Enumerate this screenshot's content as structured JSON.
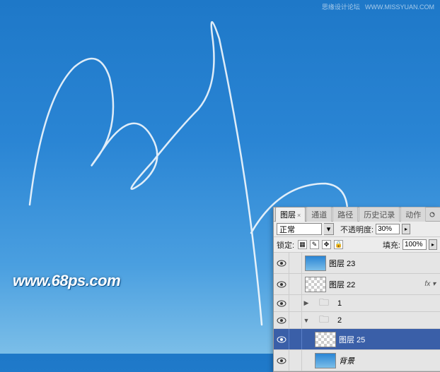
{
  "watermark": {
    "title": "思缘设计论坛",
    "url": "WWW.MISSYUAN.COM"
  },
  "logo": "www.68ps.com",
  "panel": {
    "tabs": [
      "图层",
      "通道",
      "路径",
      "历史记录",
      "动作"
    ],
    "blend_mode": "正常",
    "opacity_label": "不透明度:",
    "opacity_value": "30%",
    "lock_label": "锁定:",
    "fill_label": "填充:",
    "fill_value": "100%",
    "layers": [
      {
        "name": "图层 23",
        "thumb": "blue",
        "fx": false
      },
      {
        "name": "图层 22",
        "thumb": "checker",
        "fx": true
      },
      {
        "name": "1",
        "thumb": "folder",
        "expand": "▶"
      },
      {
        "name": "2",
        "thumb": "folder",
        "expand": "▼"
      },
      {
        "name": "图层 25",
        "thumb": "checker",
        "selected": true,
        "indent": true
      },
      {
        "name": "背景",
        "thumb": "blue",
        "indent": true,
        "italic": true
      }
    ]
  }
}
